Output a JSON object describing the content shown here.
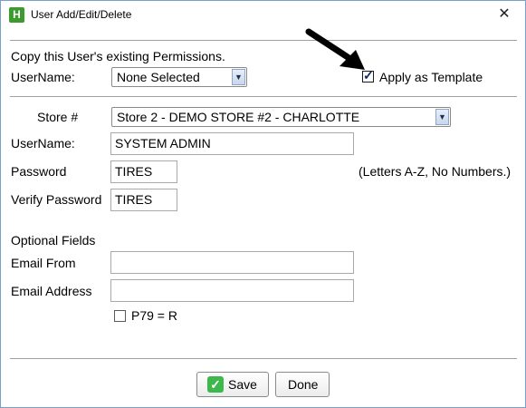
{
  "window": {
    "title": "User Add/Edit/Delete",
    "app_icon_letter": "H",
    "close_glyph": "✕"
  },
  "copy_section": {
    "heading": "Copy this User's existing Permissions.",
    "username_label": "UserName:",
    "username_value": "None Selected",
    "apply_template_label": "Apply as Template",
    "apply_template_checked": true
  },
  "form": {
    "store_label": "Store #",
    "store_value": "Store 2 - DEMO STORE #2  - CHARLOTTE",
    "username_label": "UserName:",
    "username_value": "SYSTEM ADMIN",
    "password_label": "Password",
    "password_value": "TIRES",
    "password_hint": "(Letters A-Z, No Numbers.)",
    "verify_label": "Verify Password",
    "verify_value": "TIRES"
  },
  "optional": {
    "heading": "Optional Fields",
    "email_from_label": "Email From",
    "email_from_value": "",
    "email_address_label": "Email Address",
    "email_address_value": "",
    "p79_label": "P79 = R",
    "p79_checked": false
  },
  "buttons": {
    "save_label": "Save",
    "done_label": "Done"
  },
  "icons": {
    "app": "app-logo-icon",
    "close": "close-icon",
    "dropdown": "chevron-down-icon",
    "save": "checkmark-icon",
    "annotation": "arrow-pointer-icon"
  }
}
